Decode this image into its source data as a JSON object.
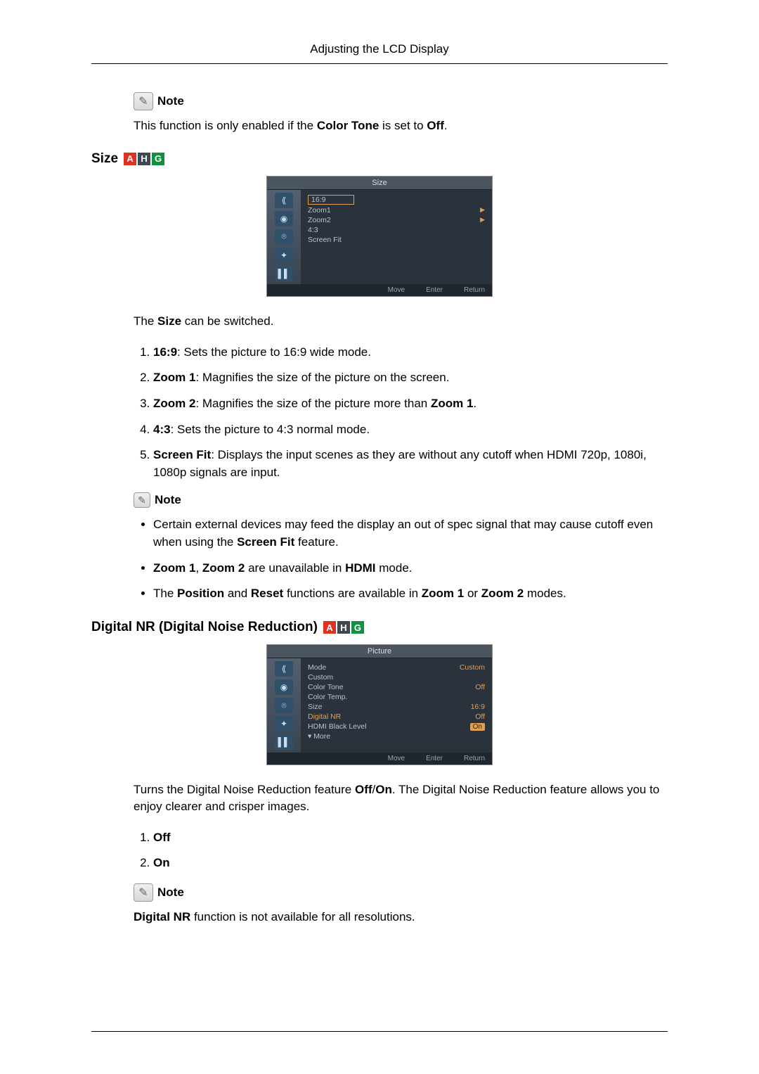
{
  "header": {
    "title": "Adjusting the LCD Display"
  },
  "note_label": "Note",
  "badges": {
    "a": "A",
    "h": "H",
    "g": "G"
  },
  "intro_note": {
    "pre": "This function is only enabled if the ",
    "bold": "Color Tone",
    "mid": " is set to ",
    "bold2": "Off",
    "post": "."
  },
  "size": {
    "heading": "Size",
    "osd_title": "Size",
    "osd_items": [
      {
        "label": "16:9",
        "selected": true
      },
      {
        "label": "Zoom1",
        "arrow": true
      },
      {
        "label": "Zoom2",
        "arrow": true
      },
      {
        "label": "4:3"
      },
      {
        "label": "Screen Fit"
      }
    ],
    "osd_footer": {
      "move": "Move",
      "enter": "Enter",
      "return": "Return"
    },
    "caption": {
      "pre": "The ",
      "bold": "Size",
      "post": " can be switched."
    },
    "list": [
      {
        "bold": "16:9",
        "text": ": Sets the picture to 16:9 wide mode."
      },
      {
        "bold": "Zoom 1",
        "text": ": Magnifies the size of the picture on the screen."
      },
      {
        "bold": "Zoom 2",
        "pre": ": Magnifies the size of the picture more than ",
        "bold2": "Zoom 1",
        "post": "."
      },
      {
        "bold": "4:3",
        "text": ": Sets the picture to 4:3 normal mode."
      },
      {
        "bold": "Screen Fit",
        "text": ": Displays the input scenes as they are without any cutoff when HDMI 720p, 1080i, 1080p signals are input."
      }
    ],
    "notes": [
      {
        "pre": "Certain external devices may feed the display an out of spec signal that may cause cutoff even when using the ",
        "bold": "Screen Fit",
        "post": " feature."
      },
      {
        "bold": "Zoom 1",
        "mid1": ", ",
        "bold2": "Zoom 2",
        "mid2": " are unavailable in ",
        "bold3": "HDMI",
        "post": " mode."
      },
      {
        "pre": "The ",
        "bold": "Position",
        "mid1": " and ",
        "bold2": "Reset",
        "mid2": " functions are available in  ",
        "bold3": "Zoom 1",
        "mid3": " or  ",
        "bold4": "Zoom 2",
        "post": " modes."
      }
    ]
  },
  "dnr": {
    "heading": "Digital NR (Digital Noise Reduction)",
    "osd_title": "Picture",
    "osd_rows": [
      {
        "label": "Mode",
        "value": "Custom"
      },
      {
        "label": "Custom"
      },
      {
        "label": "Color Tone",
        "value": "Off"
      },
      {
        "label": "Color Temp."
      },
      {
        "label": "Size",
        "value": "16:9"
      },
      {
        "label": "Digital NR",
        "value": "Off",
        "highlight": true
      },
      {
        "label": "HDMI Black Level",
        "pill": "On"
      },
      {
        "label": "▾ More"
      }
    ],
    "osd_footer": {
      "move": "Move",
      "enter": "Enter",
      "return": "Return"
    },
    "caption": {
      "pre": "Turns the Digital Noise Reduction feature ",
      "bold": "Off",
      "mid": "/",
      "bold2": "On",
      "post": ". The Digital Noise Reduction feature allows you to enjoy clearer and crisper images."
    },
    "list": [
      {
        "bold": "Off"
      },
      {
        "bold": "On"
      }
    ],
    "note_text": {
      "bold": "Digital NR",
      "post": " function is not available for all resolutions."
    }
  }
}
